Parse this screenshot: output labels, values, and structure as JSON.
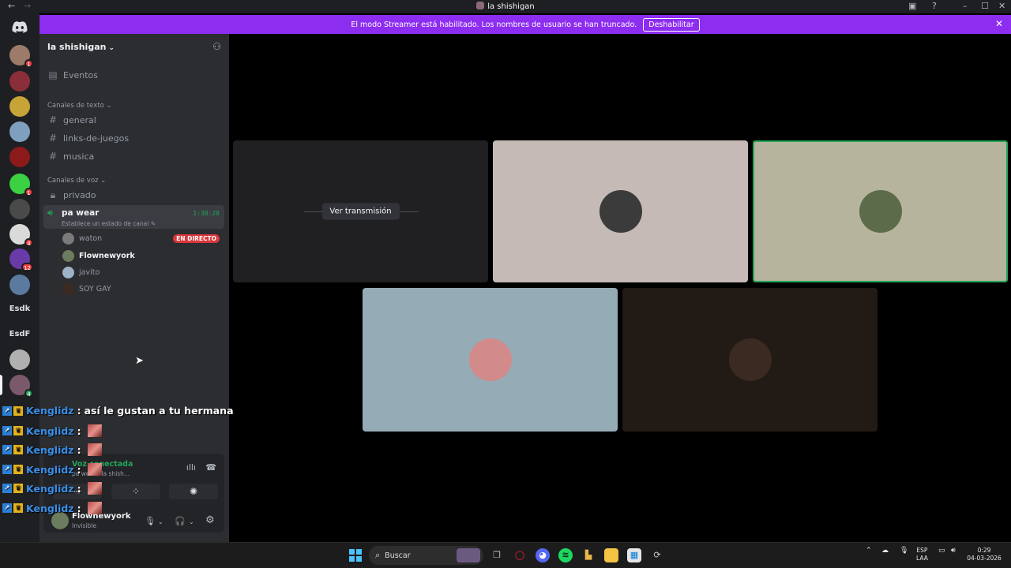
{
  "window": {
    "title": "la shishigan",
    "back_icon": "←",
    "forward_icon": "→",
    "inbox_icon": "▣",
    "help_icon": "?",
    "minimize_icon": "–",
    "maximize_icon": "☐",
    "close_icon": "✕"
  },
  "streamer_banner": {
    "text": "El modo Streamer está habilitado. Los nombres de usuario se han truncado.",
    "button": "Deshabilitar",
    "close": "✕"
  },
  "guilds": {
    "home_icon": "discord-icon",
    "items": [
      {
        "badge": "1",
        "color": "#9c7b6b"
      },
      {
        "badge": "",
        "color": "#8a2f3a"
      },
      {
        "badge": "",
        "color": "#c7a437"
      },
      {
        "badge": "",
        "color": "#7f9fbf"
      },
      {
        "badge": "",
        "color": "#8c1a1a"
      },
      {
        "badge": "1",
        "color": "#3bd142"
      },
      {
        "badge": "",
        "color": "#4a4a4a"
      },
      {
        "badge": "4",
        "color": "#dadada"
      },
      {
        "badge": "12",
        "color": "#6a3aa8"
      },
      {
        "badge": "",
        "color": "#5a7aa0"
      }
    ],
    "text_items": [
      "Esdk",
      "EsdF"
    ],
    "extra": [
      {
        "badge": "",
        "color": "#b0b0b0"
      },
      {
        "badge": "4",
        "color": "#7a5a6a"
      }
    ]
  },
  "sidebar": {
    "server_name": "la shishigan",
    "chevron": "⌄",
    "invite_icon": "⚇",
    "events": "Eventos",
    "text_category": "Canales de texto",
    "text_channels": [
      "general",
      "links-de-juegos",
      "musica"
    ],
    "voice_category": "Canales de voz",
    "voice_private": "privado",
    "voice_active": {
      "name": "pa wear",
      "timer": "1:38:28",
      "status": "Establece un estado de canal"
    },
    "voice_users": [
      {
        "name": "waton",
        "live": "EN DIRECTO",
        "color": "#7a7a7a",
        "bold": false
      },
      {
        "name": "Flownewyork",
        "live": "",
        "color": "#6b7d5e",
        "bold": true
      },
      {
        "name": "javito",
        "live": "",
        "color": "#9fb3c8",
        "bold": false
      },
      {
        "name": "SOY GAY",
        "live": "",
        "color": "#3a2a22",
        "bold": false
      }
    ]
  },
  "voice_panel": {
    "status": "Voz conectada",
    "sub": "pa wear / la shish...",
    "wave_icon": "ıllı",
    "hangup_icon": "☎",
    "buttons": [
      "⇢",
      "⁘",
      "✺"
    ],
    "me_name": "Flownewyork",
    "me_status": "Invisible",
    "mic_icon": "🎙",
    "headset_icon": "🎧",
    "settings_icon": "⚙",
    "dropdown": "⌄"
  },
  "chat_overlay": [
    {
      "user": "Kenglidz",
      "sep": ":",
      "text": "así le gustan a tu hermana",
      "emote": false
    },
    {
      "user": "Kenglidz",
      "sep": ":",
      "text": "",
      "emote": true
    },
    {
      "user": "Kenglidz",
      "sep": ":",
      "text": "",
      "emote": true
    },
    {
      "user": "Kenglidz",
      "sep": ":",
      "text": "",
      "emote": true
    },
    {
      "user": "Kenglidz",
      "sep": ":",
      "text": "",
      "emote": true
    },
    {
      "user": "Kenglidz",
      "sep": ":",
      "text": "",
      "emote": true
    }
  ],
  "stage": {
    "watch_button": "Ver transmisión",
    "tiles": [
      {
        "type": "stream",
        "bg": "#202023"
      },
      {
        "type": "user",
        "bg": "#c5bab5",
        "avatar": "#3b3b3b"
      },
      {
        "type": "user",
        "bg": "#b6b49c",
        "avatar": "#5c6b4a",
        "speaking": true
      },
      {
        "type": "user",
        "bg": "#95abb6",
        "avatar": "#d28a8a"
      },
      {
        "type": "user",
        "bg": "#221a15",
        "avatar": "#3a2a22"
      }
    ]
  },
  "taskbar": {
    "search": "Buscar",
    "search_icon": "⌕",
    "lang_top": "ESP",
    "lang_bottom": "LAA",
    "time": "0:29",
    "date": "04-03-2026"
  }
}
